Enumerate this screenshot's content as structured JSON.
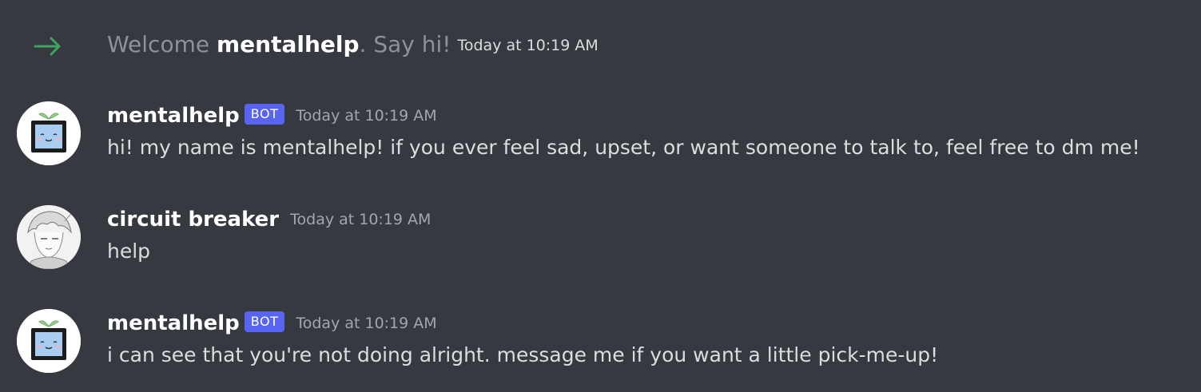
{
  "system_message": {
    "prefix": "Welcome ",
    "username": "mentalhelp",
    "suffix": ". Say hi!",
    "timestamp": "Today at 10:19 AM",
    "arrow_color": "#3ba55d"
  },
  "messages": [
    {
      "author": "mentalhelp",
      "bot_tag": "BOT",
      "timestamp": "Today at 10:19 AM",
      "content": "hi! my name is mentalhelp! if you ever feel sad, upset, or want someone to talk to, feel free to dm me!",
      "avatar": "plant-tv-avatar"
    },
    {
      "author": "circuit breaker",
      "timestamp": "Today at 10:19 AM",
      "content": "help",
      "avatar": "sketch-portrait-avatar"
    },
    {
      "author": "mentalhelp",
      "bot_tag": "BOT",
      "timestamp": "Today at 10:19 AM",
      "content": "i can see that you're not doing alright. message me if you want a little pick-me-up!",
      "avatar": "plant-tv-avatar"
    }
  ],
  "colors": {
    "background": "#36393f",
    "bot_tag": "#5865f2",
    "text": "#dcddde",
    "muted": "#a3a6aa"
  }
}
